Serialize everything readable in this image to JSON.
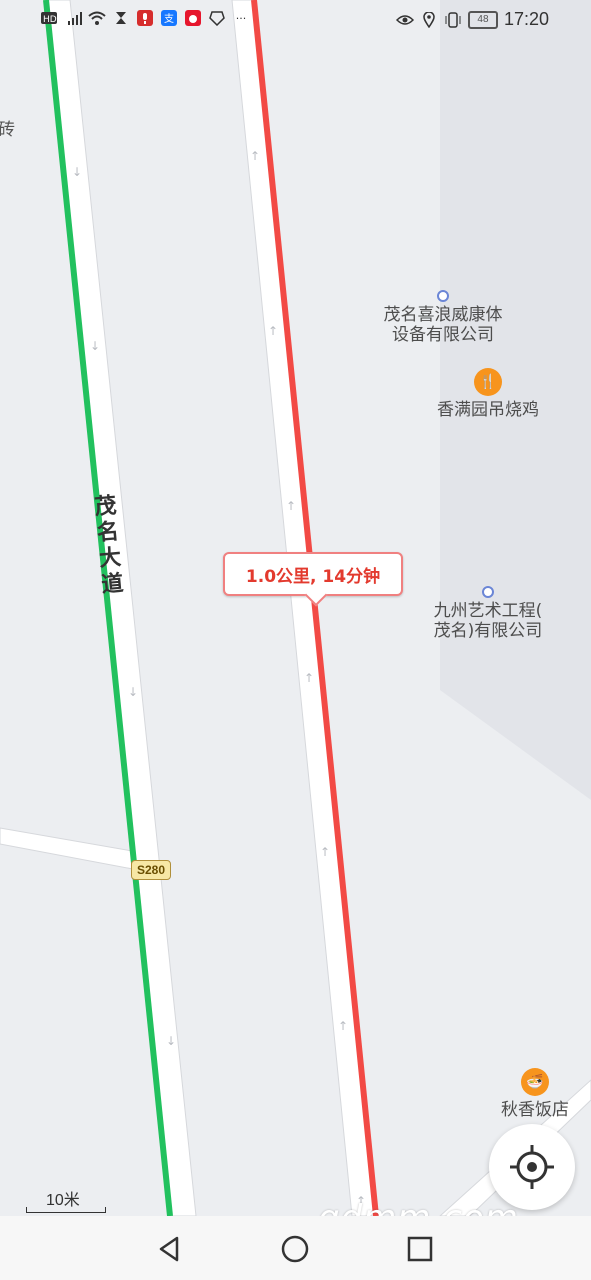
{
  "status_bar": {
    "left_icons": [
      "hd-icon",
      "4g-signal-icon",
      "wifi-icon",
      "hourglass-icon",
      "mic-icon",
      "app-icon-blue",
      "app-icon-weibo",
      "hand-icon",
      "more-icon"
    ],
    "battery": "48",
    "time": "17:20"
  },
  "map": {
    "road_label": "茂名大道",
    "highway_shield": "S280",
    "left_edge_text": "砖",
    "pois": [
      {
        "name_line1": "茂名喜浪威康体",
        "name_line2": "设备有限公司",
        "icon": "location-dot-icon"
      },
      {
        "name_line1": "香满园吊烧鸡",
        "name_line2": "",
        "icon": "restaurant-icon"
      },
      {
        "name_line1": "九州艺术工程(",
        "name_line2": "茂名)有限公司",
        "icon": "location-dot-icon"
      },
      {
        "name_line1": "秋香饭店",
        "name_line2": "",
        "icon": "restaurant-icon"
      }
    ],
    "route_tip": "1.0公里, 14分钟",
    "scale": "10米",
    "watermark": "gdmm.com"
  },
  "colors": {
    "route_red": "#f24a45",
    "route_green": "#22c15e",
    "road_white": "#ffffff",
    "poi_orange": "#f7941d"
  },
  "nav_bar": {
    "back": "back-icon",
    "home": "home-icon",
    "recents": "recents-icon"
  }
}
